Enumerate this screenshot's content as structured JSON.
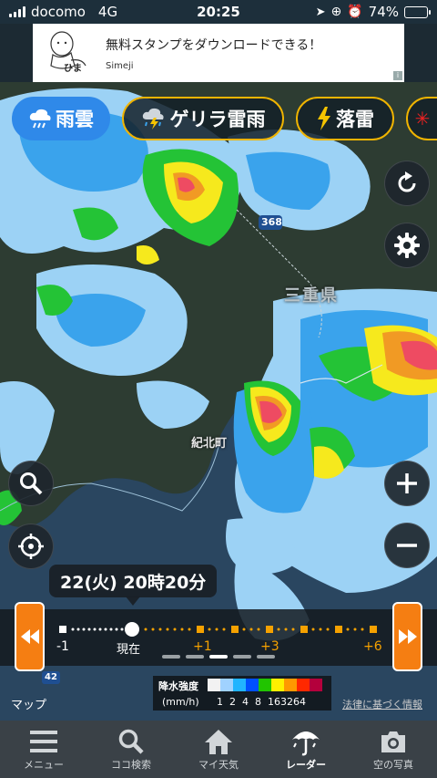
{
  "status_bar": {
    "carrier": "docomo",
    "network": "4G",
    "time": "20:25",
    "battery": "74%",
    "battery_level": 0.74
  },
  "ad": {
    "headline": "無料スタンプをダウンロードできる！",
    "brand": "Simeji",
    "mascot_text": "ひま",
    "adchoice": "i"
  },
  "layers": [
    {
      "label": "雨雲",
      "icon": "rain-cloud-icon",
      "active": true
    },
    {
      "label": "ゲリラ雷雨",
      "icon": "thunder-cloud-icon",
      "active": false
    },
    {
      "label": "落雷",
      "icon": "lightning-icon",
      "active": false
    }
  ],
  "map": {
    "route_number": "368",
    "prefecture_label": "三重県",
    "city_label": "紀北町",
    "route_number_2": "42"
  },
  "time_bubble": "22(火) 20時20分",
  "timeline": {
    "labels": [
      "-1",
      "現在",
      "+1",
      "+3",
      "+6"
    ],
    "current_position": "現在",
    "page_dots": 5,
    "active_page": 3
  },
  "legend": {
    "title": "降水強度",
    "unit": "(mm/h)",
    "values": [
      "1",
      "2",
      "4",
      "8",
      "16",
      "32",
      "64"
    ],
    "colors": [
      "#f2f2f2",
      "#a0d2ff",
      "#21b4ff",
      "#0050ff",
      "#21c400",
      "#fff000",
      "#ff9900",
      "#ff2800",
      "#b4003c"
    ]
  },
  "map_credit": "マップ",
  "law_link": "法律に基づく情報",
  "tabs": [
    {
      "label": "メニュー",
      "icon": "menu-icon",
      "active": false
    },
    {
      "label": "ココ検索",
      "icon": "search-icon",
      "active": false
    },
    {
      "label": "マイ天気",
      "icon": "home-icon",
      "active": false
    },
    {
      "label": "レーダー",
      "icon": "umbrella-icon",
      "active": true
    },
    {
      "label": "空の写真",
      "icon": "camera-icon",
      "active": false
    }
  ]
}
